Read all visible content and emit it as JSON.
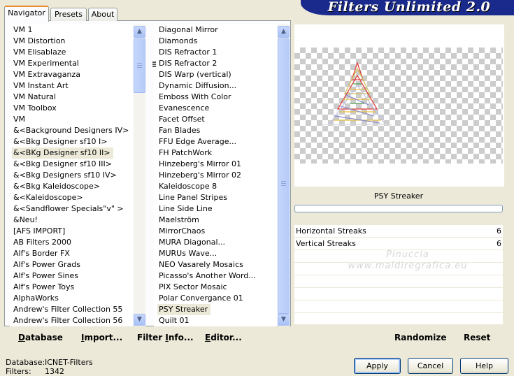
{
  "header": {
    "title": "Filters Unlimited 2.0",
    "tabs": [
      {
        "label": "Navigator",
        "active": true
      },
      {
        "label": "Presets",
        "active": false
      },
      {
        "label": "About",
        "active": false
      }
    ]
  },
  "categories": {
    "items": [
      "VM 1",
      "VM Distortion",
      "VM Elisablaze",
      "VM Experimental",
      "VM Extravaganza",
      "VM Instant Art",
      "VM Natural",
      "VM Toolbox",
      "VM",
      "&<Background Designers IV>",
      "&<Bkg Designer sf10 I>",
      "&<BKg Designer sf10 II>",
      "&<Bkg Designer sf10 III>",
      "&<Bkg Designers sf10 IV>",
      "&<Bkg Kaleidoscope>",
      "&<Kaleidoscope>",
      "&<Sandflower Specials\"v\" >",
      "&Neu!",
      "[AFS IMPORT]",
      "AB Filters 2000",
      "Alf's Border FX",
      "Alf's Power Grads",
      "Alf's Power Sines",
      "Alf's Power Toys",
      "AlphaWorks",
      "Andrew's Filter Collection 55",
      "Andrew's Filter Collection 56"
    ],
    "selected": "&<BKg Designer sf10 II>"
  },
  "filters": {
    "items": [
      "Diagonal Mirror",
      "Diamonds",
      "DIS Refractor 1",
      "DIS Refractor 2",
      "DIS Warp (vertical)",
      "Dynamic Diffusion...",
      "Emboss With Color",
      "Evanescence",
      "Facet Offset",
      "Fan Blades",
      "FFU Edge Average...",
      "FH PatchWork",
      "Hinzeberg's Mirror 01",
      "Hinzeberg's Mirror 02",
      "Kaleidoscope 8",
      "Line Panel Stripes",
      "Line Side Line",
      "Maelström",
      "MirrorChaos",
      "MURA Diagonal...",
      "MURUs Wave...",
      "NEO Vasarely Mosaics",
      "Picasso's Another Word...",
      "PIX Sector Mosaic",
      "Polar Convergance 01",
      "PSY Streaker",
      "Quilt 01"
    ],
    "selected": "PSY Streaker"
  },
  "preview": {
    "filter_name": "PSY Streaker",
    "progress": 0,
    "watermark_line1": "Pinuccia",
    "watermark_line2": "www.maldiregrafica.eu"
  },
  "params": [
    {
      "label": "Horizontal Streaks",
      "value": "6"
    },
    {
      "label": "Vertical Streaks",
      "value": "6"
    }
  ],
  "toolbar": {
    "database_prefix": "D",
    "database_rest": "atabase",
    "import_prefix": "I",
    "import_rest": "mport...",
    "filterinfo_a": "Filter ",
    "filterinfo_u": "I",
    "filterinfo_b": "nfo...",
    "editor_prefix": "E",
    "editor_rest": "ditor...",
    "randomize": "Randomize",
    "reset": "Reset"
  },
  "status": {
    "database_label": "Database:",
    "database_value": "ICNET-Filters",
    "filters_label": "Filters:",
    "filters_value": "1342"
  },
  "buttons": {
    "apply": "Apply",
    "cancel": "Cancel",
    "help": "Help"
  }
}
